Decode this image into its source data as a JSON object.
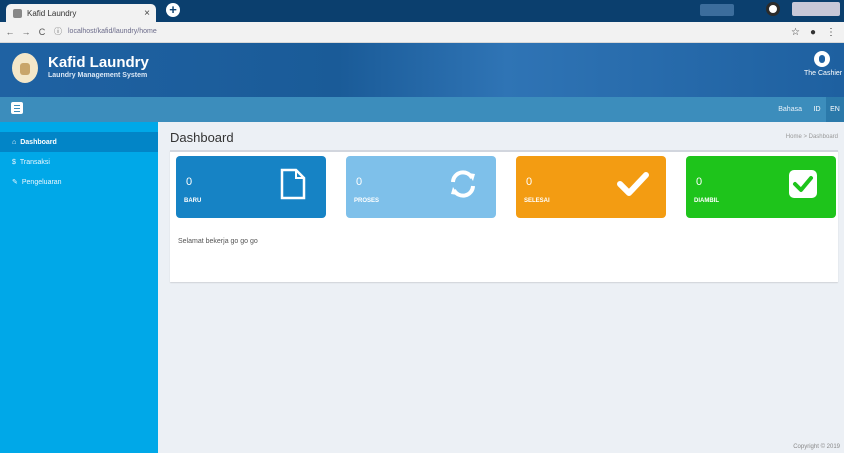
{
  "browser": {
    "tab_title": "Kafid Laundry",
    "tab_close": "×",
    "new_tab": "+",
    "url": "localhost/kafid/laundry/home",
    "nav_back": "←",
    "nav_forward": "→",
    "nav_reload": "C",
    "star": "☆"
  },
  "header": {
    "brand_title": "Kafid Laundry",
    "brand_sub": "Laundry Management System",
    "user_name": "The Cashier"
  },
  "toolbar": {
    "lang_label": "Bahasa",
    "btn_id": "ID",
    "btn_en": "EN"
  },
  "sidebar": {
    "items": [
      {
        "label": "Dashboard",
        "icon": "home-icon",
        "glyph": "⌂",
        "active": true
      },
      {
        "label": "Transaksi",
        "icon": "dollar-icon",
        "glyph": "$",
        "active": false
      },
      {
        "label": "Pengeluaran",
        "icon": "edit-icon",
        "glyph": "✎",
        "active": false
      }
    ]
  },
  "main": {
    "title": "Dashboard",
    "breadcrumb": "Home > Dashboard",
    "tiles": [
      {
        "value": "0",
        "label": "BARU",
        "color": "#1683c5",
        "icon": "file-icon"
      },
      {
        "value": "0",
        "label": "PROSES",
        "color": "#7ec0ea",
        "icon": "refresh-icon"
      },
      {
        "value": "0",
        "label": "SELESAI",
        "color": "#f39c12",
        "icon": "check-icon"
      },
      {
        "value": "0",
        "label": "DIAMBIL",
        "color": "#1ec41b",
        "icon": "check-square-icon"
      }
    ],
    "panel_text": "Selamat bekerja go go go"
  },
  "footer": {
    "text": "Copyright © 2019"
  },
  "colors": {
    "header": "#1f62a3",
    "toolbar": "#3c8dbc",
    "sidebar": "#00a8e8",
    "sidebar_active": "#0285c7"
  }
}
